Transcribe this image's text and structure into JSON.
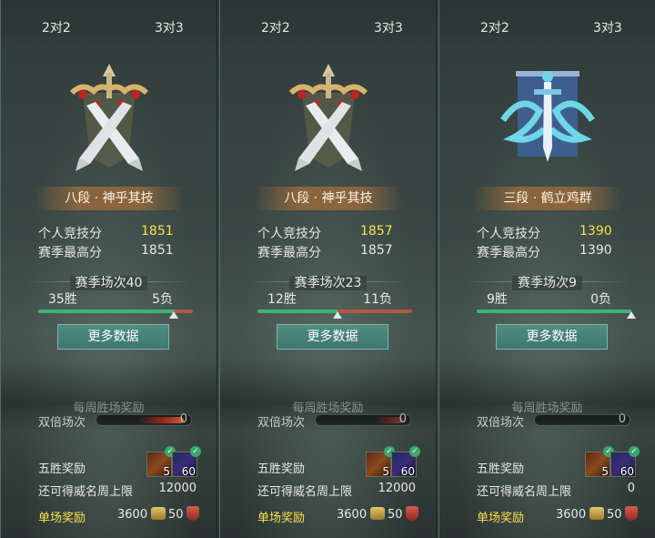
{
  "panels": [
    {
      "tabs": [
        "2对2",
        "3对3"
      ],
      "rank": "八段 · 神乎其技",
      "emblem": "crossed-swords-icon",
      "personal_score_label": "个人竞技分",
      "personal_score": "1851",
      "season_high_label": "赛季最高分",
      "season_high": "1851",
      "season_matches": "赛季场次40",
      "wins": "35胜",
      "losses": "5负",
      "win_ratio": 0.875,
      "more_data": "更多数据",
      "weekly_reward": "每周胜场奖励",
      "double_label": "双倍场次",
      "double_value": "0",
      "five_win_reward": "五胜奖励",
      "item_counts": [
        "5",
        "60"
      ],
      "limit_label": "还可得威名周上限",
      "limit_value": "12000",
      "single_reward": "单场奖励",
      "reward_coins": "3600",
      "reward_points": "50"
    },
    {
      "tabs": [
        "2对2",
        "3对3"
      ],
      "rank": "八段 · 神乎其技",
      "emblem": "crossed-swords-icon",
      "personal_score_label": "个人竞技分",
      "personal_score": "1857",
      "season_high_label": "赛季最高分",
      "season_high": "1857",
      "season_matches": "赛季场次23",
      "wins": "12胜",
      "losses": "11负",
      "win_ratio": 0.52,
      "more_data": "更多数据",
      "weekly_reward": "每周胜场奖励",
      "double_label": "双倍场次",
      "double_value": "0",
      "five_win_reward": "五胜奖励",
      "item_counts": [
        "5",
        "60"
      ],
      "limit_label": "还可得威名周上限",
      "limit_value": "12000",
      "single_reward": "单场奖励",
      "reward_coins": "3600",
      "reward_points": "50"
    },
    {
      "tabs": [
        "2对2",
        "3对3"
      ],
      "rank": "三段 · 鹤立鸡群",
      "emblem": "dragon-sword-icon",
      "personal_score_label": "个人竞技分",
      "personal_score": "1390",
      "season_high_label": "赛季最高分",
      "season_high": "1390",
      "season_matches": "赛季场次9",
      "wins": "9胜",
      "losses": "0负",
      "win_ratio": 1.0,
      "more_data": "更多数据",
      "weekly_reward": "每周胜场奖励",
      "double_label": "双倍场次",
      "double_value": "0",
      "five_win_reward": "五胜奖励",
      "item_counts": [
        "5",
        "60"
      ],
      "limit_label": "还可得威名周上限",
      "limit_value": "0",
      "single_reward": "单场奖励",
      "reward_coins": "3600",
      "reward_points": "50"
    }
  ],
  "colors": {
    "score": "#f6e24c",
    "win": "#3fb27a",
    "loss": "#b05a3a",
    "button": "#4f8c82"
  }
}
